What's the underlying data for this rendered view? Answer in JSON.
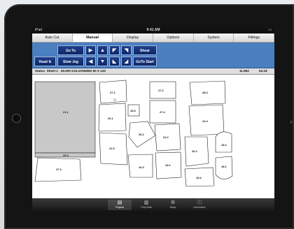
{
  "device": {
    "carrier": "iPad",
    "time": "9:41 AM"
  },
  "tabs": [
    "Auto Cut",
    "Manual",
    "Display",
    "Options",
    "System",
    "Fittings"
  ],
  "active_tab": "Manual",
  "controls": {
    "goto": "Go To",
    "shear": "Shear",
    "head": "Head",
    "slow_jog": "Slow Jog",
    "goto_start": "GoTo Start"
  },
  "status_row": {
    "status": "Status",
    "sheet": "Sheet 1",
    "material": "26.000 GALVANIZED 60 X 120",
    "value1": "11.952",
    "value2": "54.18"
  },
  "parts": [
    "27.1",
    "27.2",
    "28.4",
    "21.1",
    "18.3",
    "20.1",
    "27.4",
    "22.4",
    "26.2",
    "22.2",
    "18.2",
    "20.3",
    "22.3",
    "20.2",
    "18.1",
    "27.3",
    "16.3",
    "19.1",
    "18.4"
  ],
  "tabbar": [
    "Projects",
    "Prep Data",
    "Setup",
    "Information"
  ],
  "colors": {
    "panel": "#4a7fc0",
    "button": "#1f3e8a",
    "sheet_gray": "#c8c8c8"
  }
}
